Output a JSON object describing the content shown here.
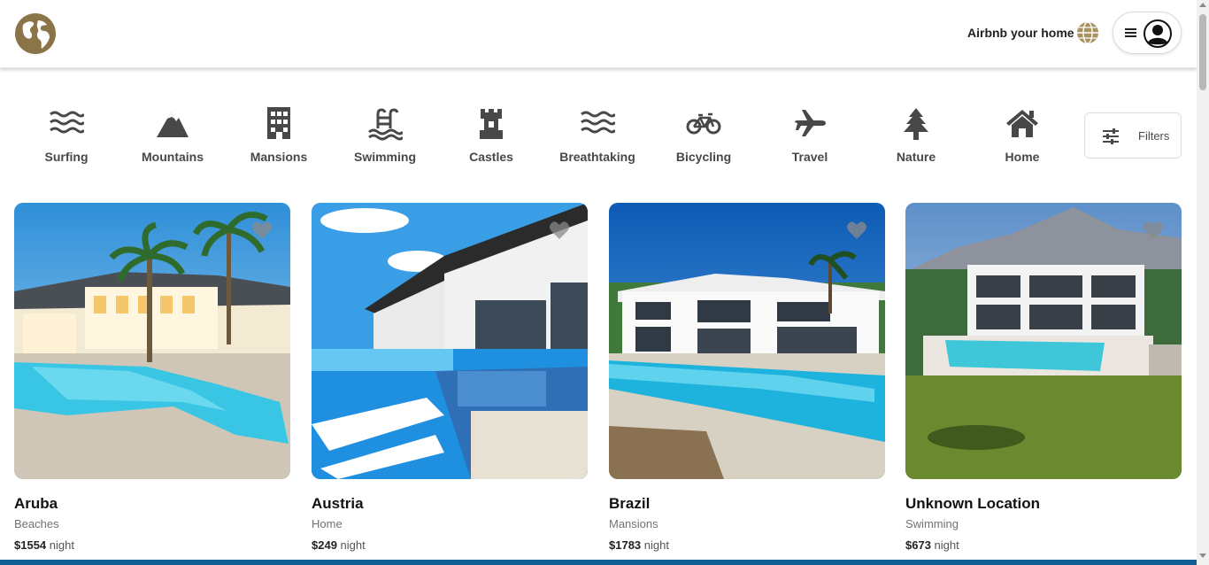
{
  "header": {
    "logo_icon": "globe-logo-icon",
    "host_link": "Airbnb your home",
    "globe_icon": "globe-icon",
    "menu_icon": "hamburger-icon",
    "avatar_icon": "user-avatar-icon",
    "accent_color": "#8c7449"
  },
  "categories": [
    {
      "label": "Surfing",
      "icon": "waves-icon"
    },
    {
      "label": "Mountains",
      "icon": "mountain-icon"
    },
    {
      "label": "Mansions",
      "icon": "building-icon"
    },
    {
      "label": "Swimming",
      "icon": "pool-icon"
    },
    {
      "label": "Castles",
      "icon": "castle-icon"
    },
    {
      "label": "Breathtaking",
      "icon": "waves-icon"
    },
    {
      "label": "Bicycling",
      "icon": "bicycle-icon"
    },
    {
      "label": "Travel",
      "icon": "airplane-icon"
    },
    {
      "label": "Nature",
      "icon": "tree-icon"
    },
    {
      "label": "Home",
      "icon": "house-icon"
    }
  ],
  "filters": {
    "label": "Filters",
    "icon": "sliders-icon"
  },
  "listings": [
    {
      "title": "Aruba",
      "category": "Beaches",
      "price": "$1554",
      "unit": "night"
    },
    {
      "title": "Austria",
      "category": "Home",
      "price": "$249",
      "unit": "night"
    },
    {
      "title": "Brazil",
      "category": "Mansions",
      "price": "$1783",
      "unit": "night"
    },
    {
      "title": "Unknown Location",
      "category": "Swimming",
      "price": "$673",
      "unit": "night"
    }
  ]
}
